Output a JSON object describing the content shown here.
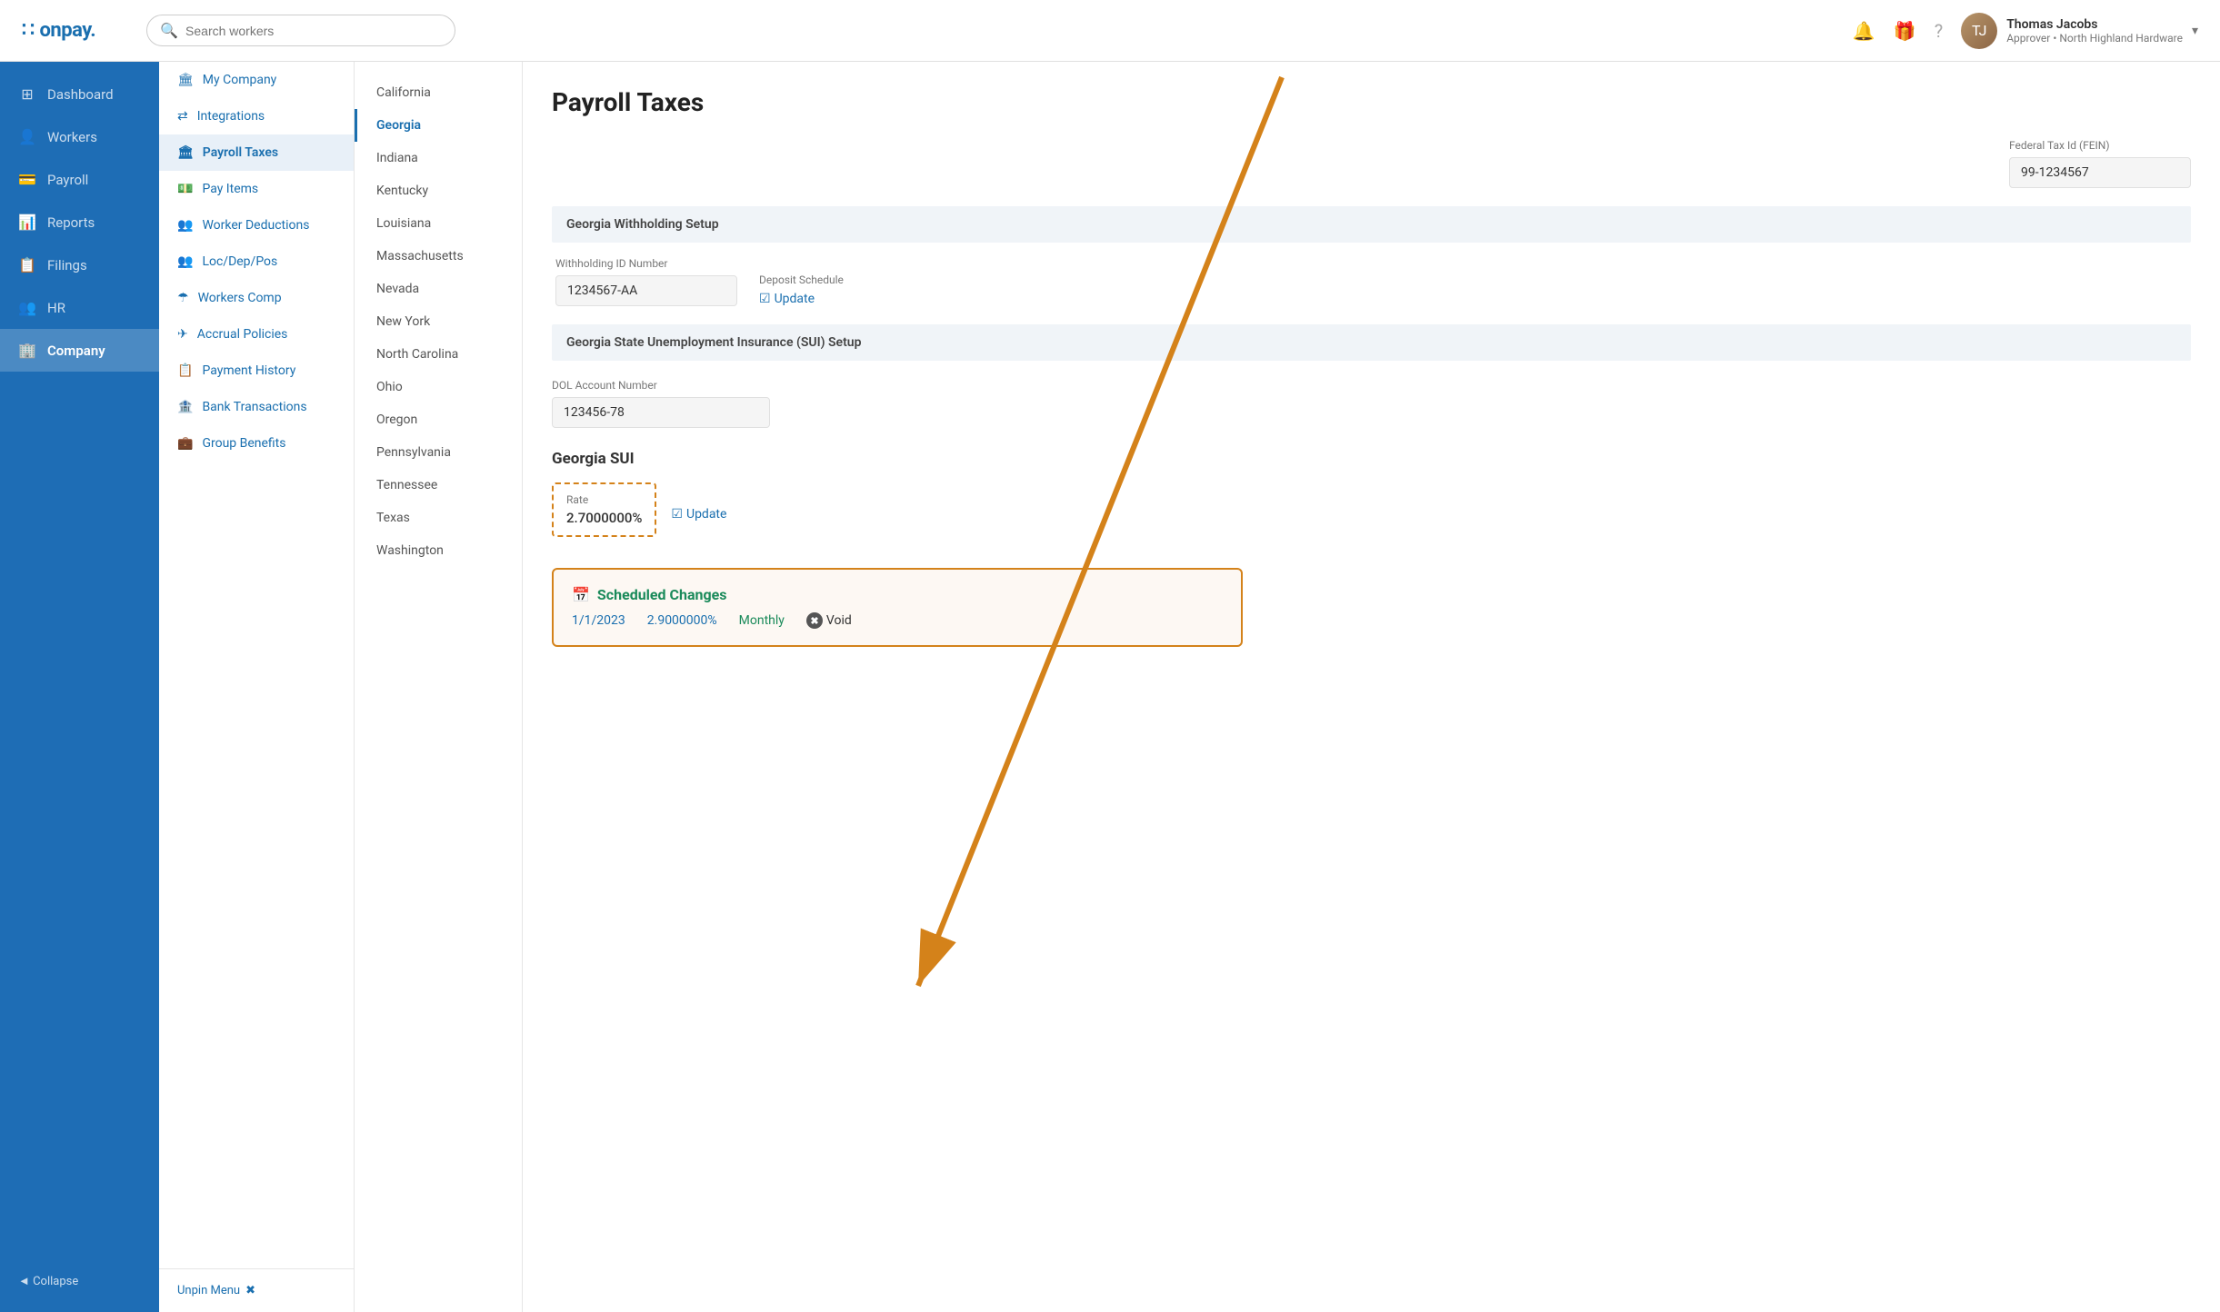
{
  "header": {
    "logo_text": "onpay.",
    "logo_dots": "∷",
    "search_placeholder": "Search workers",
    "bell_icon": "🔔",
    "gift_icon": "🎁",
    "help_icon": "?",
    "user_name": "Thomas Jacobs",
    "user_role": "Approver • North Highland Hardware",
    "chevron": "▾"
  },
  "sidebar": {
    "items": [
      {
        "id": "dashboard",
        "label": "Dashboard",
        "icon": "⊞"
      },
      {
        "id": "workers",
        "label": "Workers",
        "icon": "👤"
      },
      {
        "id": "payroll",
        "label": "Payroll",
        "icon": "💳"
      },
      {
        "id": "reports",
        "label": "Reports",
        "icon": "📊"
      },
      {
        "id": "filings",
        "label": "Filings",
        "icon": "📋"
      },
      {
        "id": "hr",
        "label": "HR",
        "icon": "👥"
      },
      {
        "id": "company",
        "label": "Company",
        "icon": "🏢"
      }
    ],
    "collapse_label": "◄ Collapse"
  },
  "sub_menu": {
    "items": [
      {
        "id": "my-company",
        "label": "My Company",
        "icon": "🏛"
      },
      {
        "id": "integrations",
        "label": "Integrations",
        "icon": "⇄"
      },
      {
        "id": "payroll-taxes",
        "label": "Payroll Taxes",
        "icon": "🏛",
        "active": true
      },
      {
        "id": "pay-items",
        "label": "Pay Items",
        "icon": "💵"
      },
      {
        "id": "worker-deductions",
        "label": "Worker Deductions",
        "icon": "👥"
      },
      {
        "id": "loc-dep-pos",
        "label": "Loc/Dep/Pos",
        "icon": "👥"
      },
      {
        "id": "workers-comp",
        "label": "Workers Comp",
        "icon": "☂"
      },
      {
        "id": "accrual-policies",
        "label": "Accrual Policies",
        "icon": "✈"
      },
      {
        "id": "payment-history",
        "label": "Payment History",
        "icon": "📋"
      },
      {
        "id": "bank-transactions",
        "label": "Bank Transactions",
        "icon": "🏦"
      },
      {
        "id": "group-benefits",
        "label": "Group Benefits",
        "icon": "💼"
      }
    ],
    "unpin_label": "Unpin Menu",
    "unpin_icon": "✖"
  },
  "states": [
    {
      "id": "california",
      "label": "California"
    },
    {
      "id": "georgia",
      "label": "Georgia",
      "active": true
    },
    {
      "id": "indiana",
      "label": "Indiana"
    },
    {
      "id": "kentucky",
      "label": "Kentucky"
    },
    {
      "id": "louisiana",
      "label": "Louisiana"
    },
    {
      "id": "massachusetts",
      "label": "Massachusetts"
    },
    {
      "id": "nevada",
      "label": "Nevada"
    },
    {
      "id": "new-york",
      "label": "New York"
    },
    {
      "id": "north-carolina",
      "label": "North Carolina"
    },
    {
      "id": "ohio",
      "label": "Ohio"
    },
    {
      "id": "oregon",
      "label": "Oregon"
    },
    {
      "id": "pennsylvania",
      "label": "Pennsylvania"
    },
    {
      "id": "tennessee",
      "label": "Tennessee"
    },
    {
      "id": "texas",
      "label": "Texas"
    },
    {
      "id": "washington",
      "label": "Washington"
    }
  ],
  "page": {
    "title": "Payroll Taxes",
    "fein_label": "Federal Tax Id (FEIN)",
    "fein_value": "99-1234567",
    "withholding_section_title": "Georgia Withholding Setup",
    "withholding_id_label": "Withholding ID Number",
    "withholding_id_value": "1234567-AA",
    "deposit_schedule_label": "Deposit Schedule",
    "update_label": "Update",
    "sui_section_title": "Georgia State Unemployment Insurance (SUI) Setup",
    "dol_account_label": "DOL Account Number",
    "dol_account_value": "123456-78",
    "georgia_sui_title": "Georgia SUI",
    "rate_label": "Rate",
    "rate_value": "2.7000000%",
    "sui_update_label": "Update",
    "scheduled_changes_title": "Scheduled Changes",
    "sc_date": "1/1/2023",
    "sc_rate": "2.9000000%",
    "sc_frequency": "Monthly",
    "sc_void_label": "Void"
  }
}
